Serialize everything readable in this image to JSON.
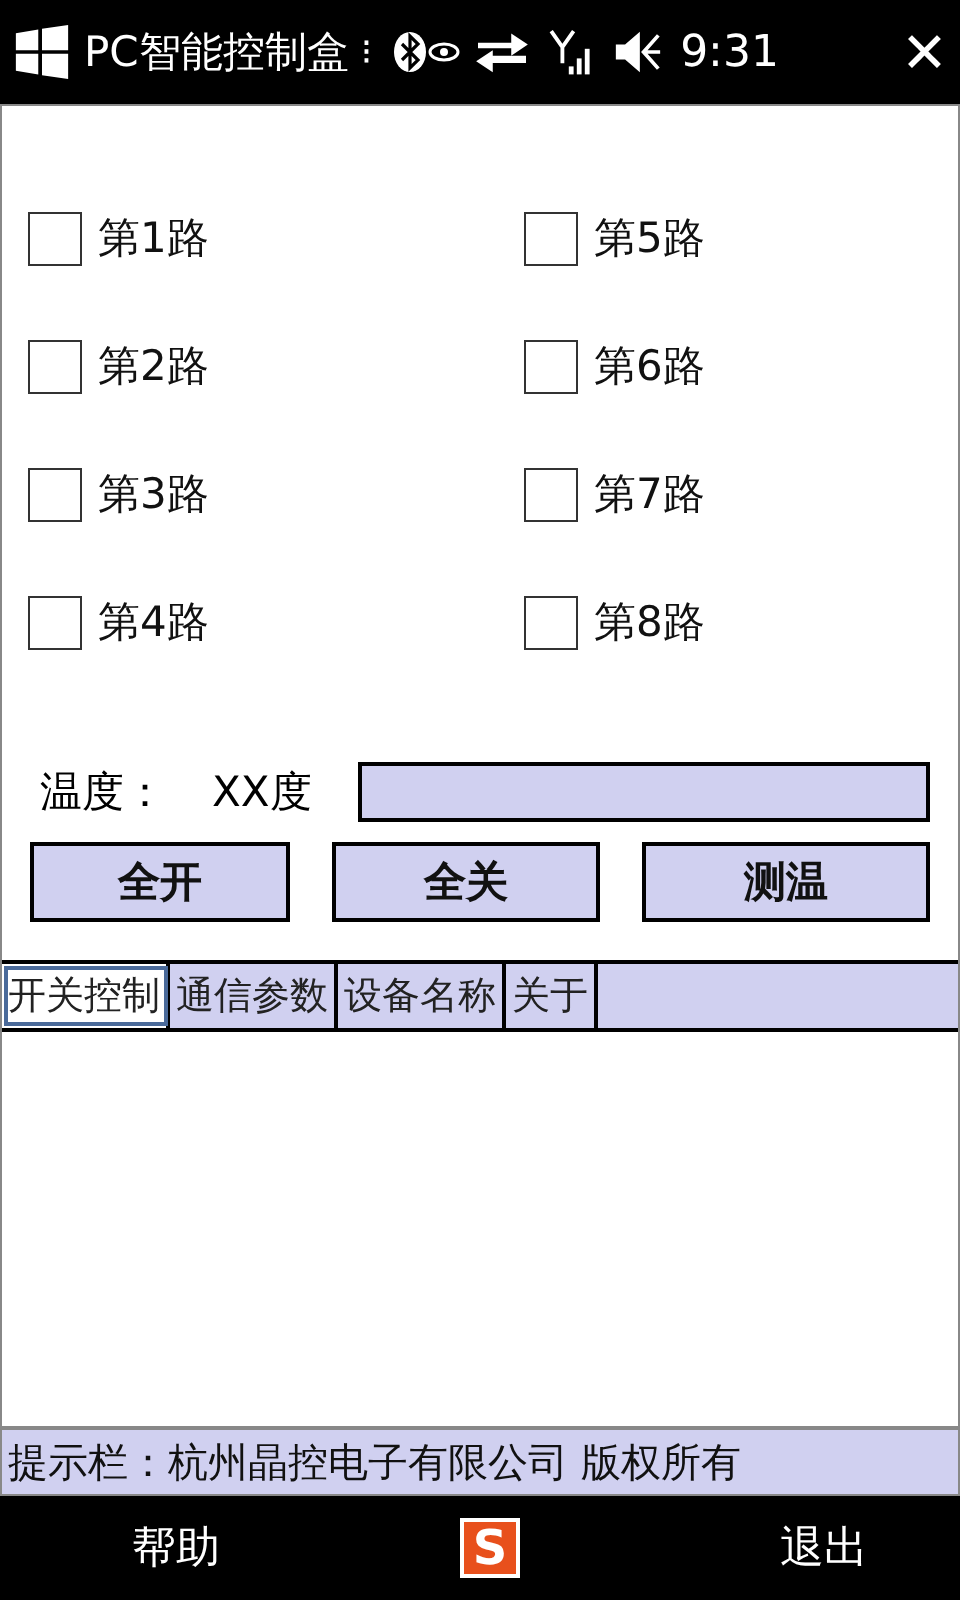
{
  "status_bar": {
    "app_title": "PC智能控制盒",
    "overflow": "⁝",
    "time": "9:31",
    "close": "✕"
  },
  "channels": [
    {
      "label": "第1路",
      "checked": false
    },
    {
      "label": "第5路",
      "checked": false
    },
    {
      "label": "第2路",
      "checked": false
    },
    {
      "label": "第6路",
      "checked": false
    },
    {
      "label": "第3路",
      "checked": false
    },
    {
      "label": "第7路",
      "checked": false
    },
    {
      "label": "第4路",
      "checked": false
    },
    {
      "label": "第8路",
      "checked": false
    }
  ],
  "temperature": {
    "label": "温度：",
    "value": "XX度"
  },
  "buttons": [
    "全开",
    "全关",
    "测温"
  ],
  "tabs": [
    {
      "label": "开关控制",
      "selected": true
    },
    {
      "label": "通信参数",
      "selected": false
    },
    {
      "label": "设备名称",
      "selected": false
    },
    {
      "label": "关于",
      "selected": false
    }
  ],
  "hint_bar": "提示栏：杭州晶控电子有限公司 版权所有",
  "softkeys": {
    "left": "帮助",
    "ime_icon": "S",
    "right": "退出"
  }
}
